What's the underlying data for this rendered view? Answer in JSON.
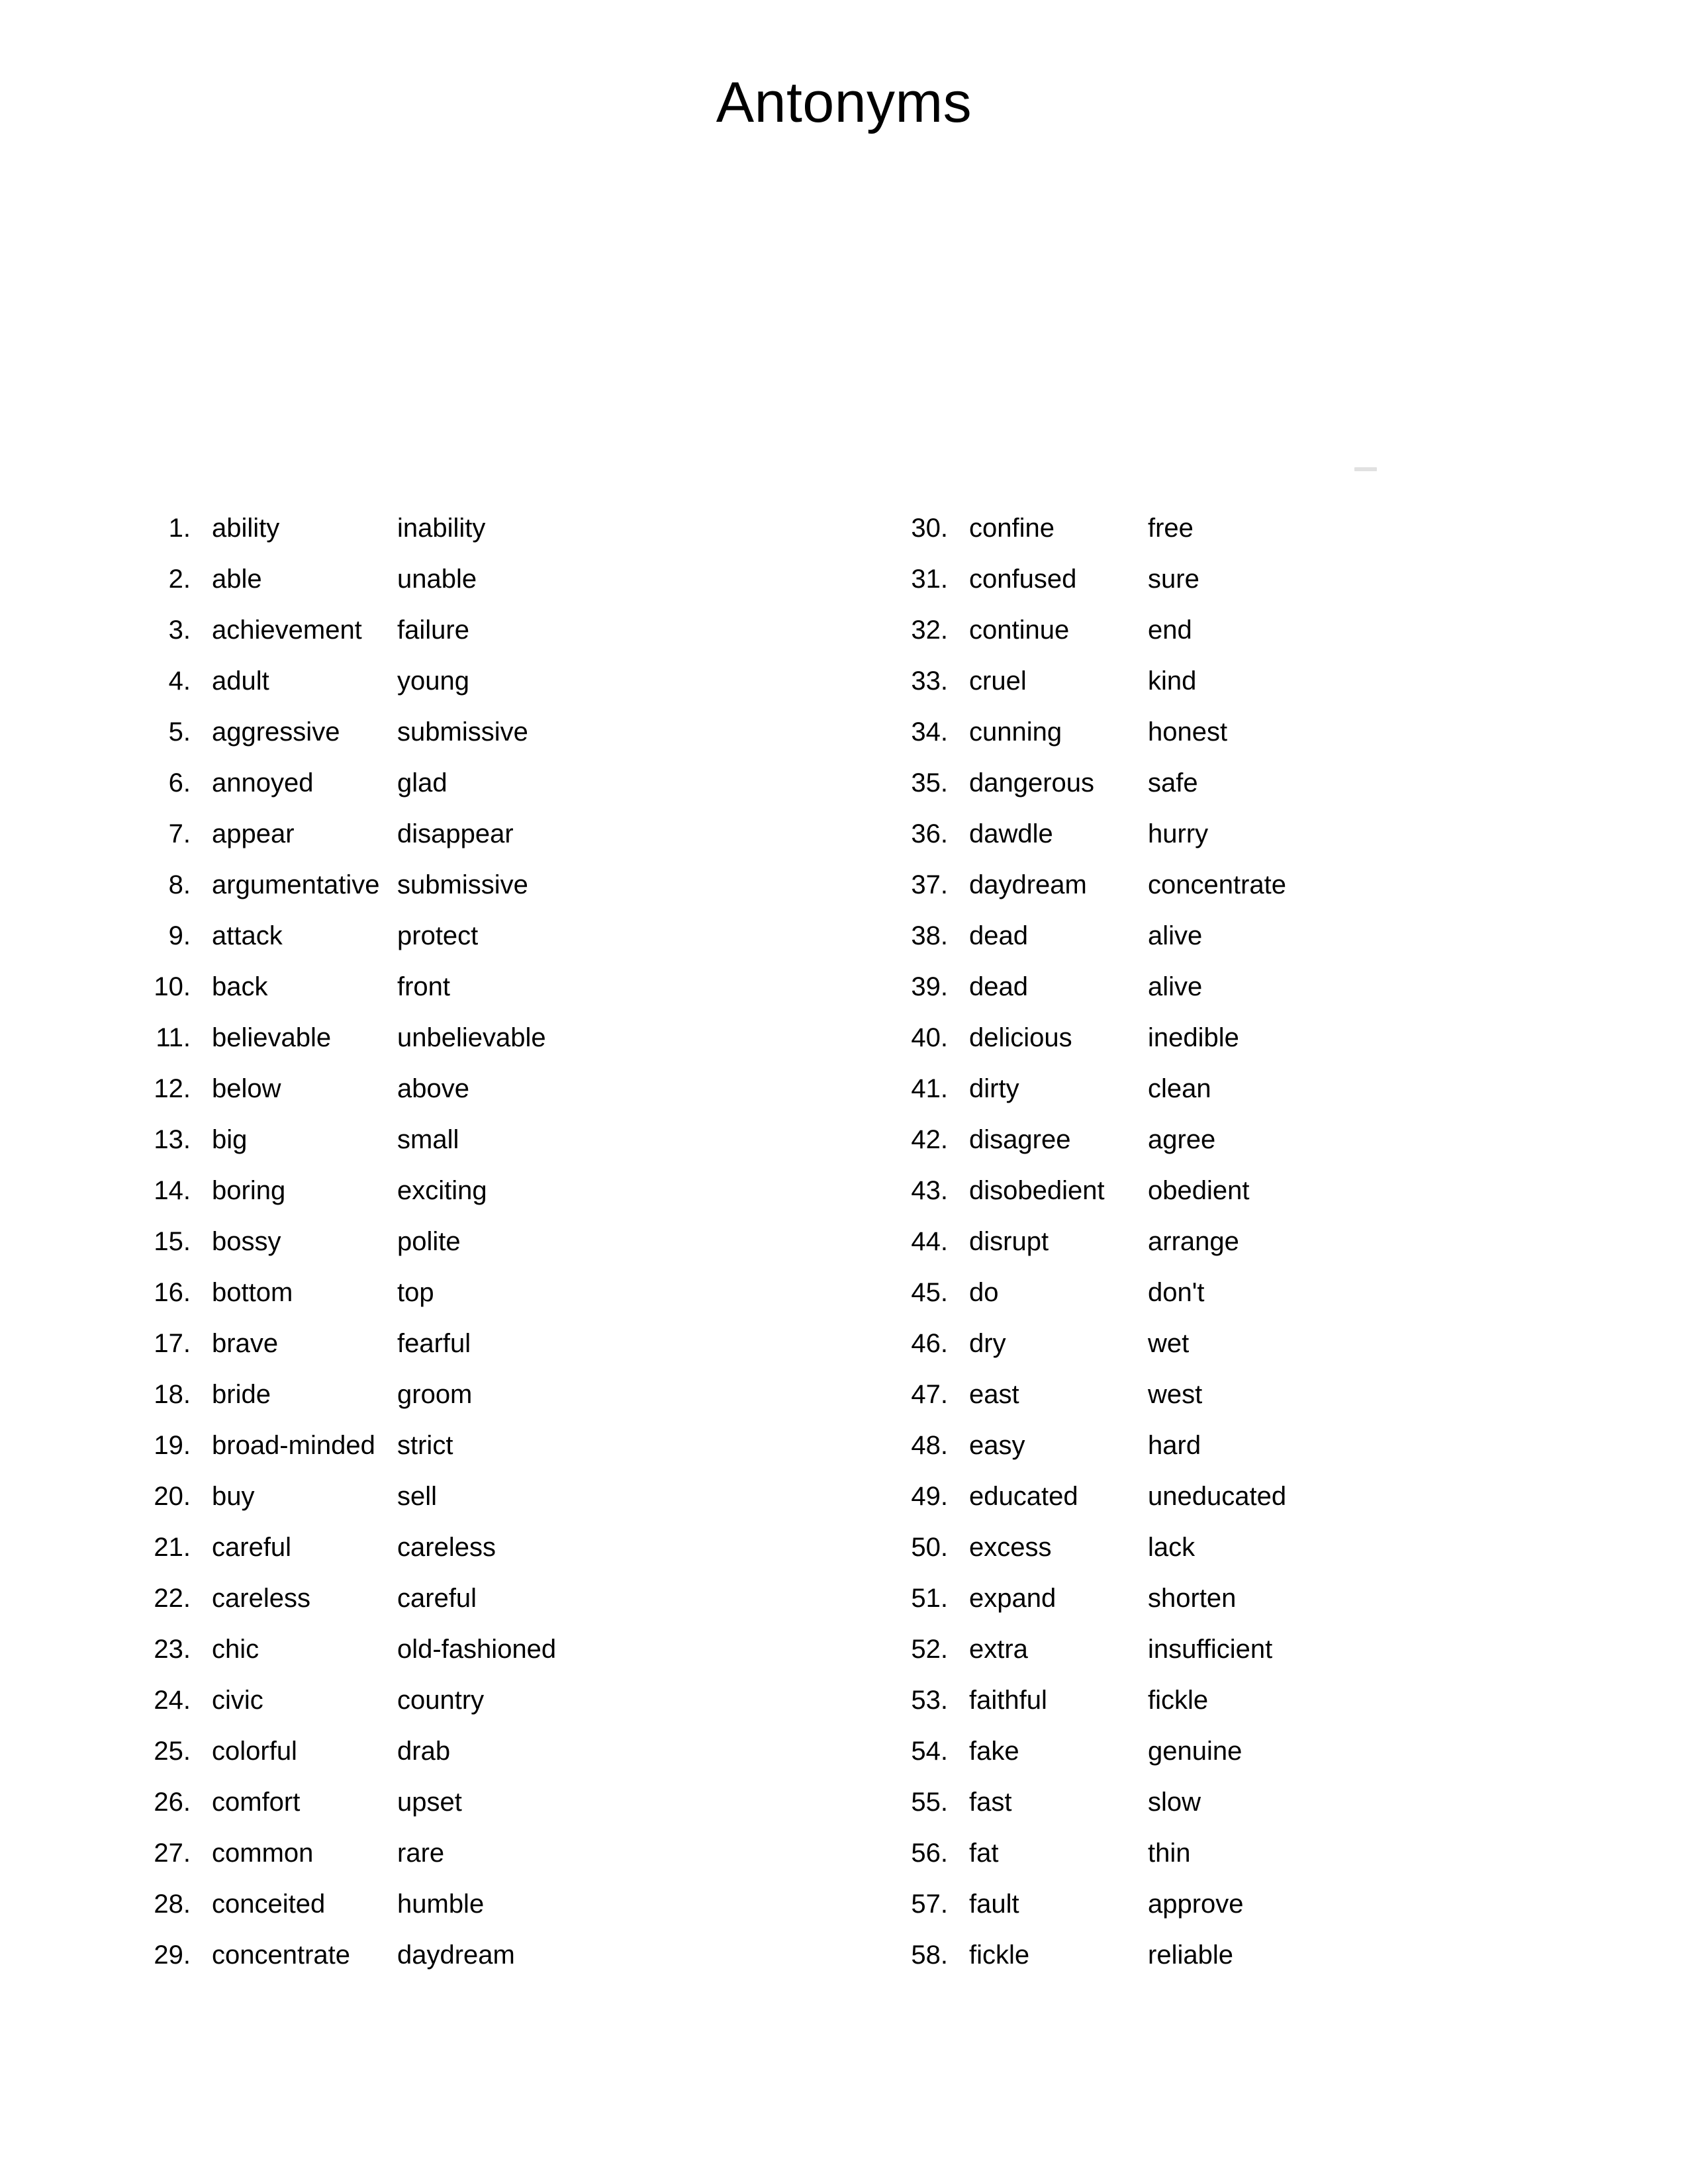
{
  "document": {
    "title": "Antonyms"
  },
  "columns": {
    "left": [
      {
        "num": "1.",
        "word": "ability",
        "antonym": "inability"
      },
      {
        "num": "2.",
        "word": "able",
        "antonym": "unable"
      },
      {
        "num": "3.",
        "word": "achievement",
        "antonym": "failure"
      },
      {
        "num": "4.",
        "word": "adult",
        "antonym": "young"
      },
      {
        "num": "5.",
        "word": "aggressive",
        "antonym": "submissive"
      },
      {
        "num": "6.",
        "word": "annoyed",
        "antonym": "glad"
      },
      {
        "num": "7.",
        "word": "appear",
        "antonym": "disappear"
      },
      {
        "num": "8.",
        "word": "argumentative",
        "antonym": "submissive"
      },
      {
        "num": "9.",
        "word": "attack",
        "antonym": "protect"
      },
      {
        "num": "10.",
        "word": "back",
        "antonym": "front"
      },
      {
        "num": "11.",
        "word": "believable",
        "antonym": "unbelievable"
      },
      {
        "num": "12.",
        "word": "below",
        "antonym": "above"
      },
      {
        "num": "13.",
        "word": "big",
        "antonym": "small"
      },
      {
        "num": "14.",
        "word": "boring",
        "antonym": "exciting"
      },
      {
        "num": "15.",
        "word": "bossy",
        "antonym": "polite"
      },
      {
        "num": "16.",
        "word": "bottom",
        "antonym": "top"
      },
      {
        "num": "17.",
        "word": "brave",
        "antonym": "fearful"
      },
      {
        "num": "18.",
        "word": "bride",
        "antonym": "groom"
      },
      {
        "num": "19.",
        "word": "broad-minded",
        "antonym": "strict"
      },
      {
        "num": "20.",
        "word": "buy",
        "antonym": "sell"
      },
      {
        "num": "21.",
        "word": "careful",
        "antonym": "careless"
      },
      {
        "num": "22.",
        "word": "careless",
        "antonym": "careful"
      },
      {
        "num": "23.",
        "word": "chic",
        "antonym": "old-fashioned"
      },
      {
        "num": "24.",
        "word": "civic",
        "antonym": "country"
      },
      {
        "num": "25.",
        "word": "colorful",
        "antonym": "drab"
      },
      {
        "num": "26.",
        "word": "comfort",
        "antonym": "upset"
      },
      {
        "num": "27.",
        "word": "common",
        "antonym": "rare"
      },
      {
        "num": "28.",
        "word": "conceited",
        "antonym": "humble"
      },
      {
        "num": "29.",
        "word": "concentrate",
        "antonym": "daydream"
      }
    ],
    "right": [
      {
        "num": "30.",
        "word": "confine",
        "antonym": "free"
      },
      {
        "num": "31.",
        "word": "confused",
        "antonym": "sure"
      },
      {
        "num": "32.",
        "word": "continue",
        "antonym": "end"
      },
      {
        "num": "33.",
        "word": "cruel",
        "antonym": "kind"
      },
      {
        "num": "34.",
        "word": "cunning",
        "antonym": "honest"
      },
      {
        "num": "35.",
        "word": "dangerous",
        "antonym": "safe"
      },
      {
        "num": "36.",
        "word": "dawdle",
        "antonym": "hurry"
      },
      {
        "num": "37.",
        "word": "daydream",
        "antonym": "concentrate"
      },
      {
        "num": "38.",
        "word": "dead",
        "antonym": "alive"
      },
      {
        "num": "39.",
        "word": "dead",
        "antonym": "alive"
      },
      {
        "num": "40.",
        "word": "delicious",
        "antonym": "inedible"
      },
      {
        "num": "41.",
        "word": "dirty",
        "antonym": "clean"
      },
      {
        "num": "42.",
        "word": "disagree",
        "antonym": "agree"
      },
      {
        "num": "43.",
        "word": "disobedient",
        "antonym": "obedient"
      },
      {
        "num": "44.",
        "word": "disrupt",
        "antonym": "arrange"
      },
      {
        "num": "45.",
        "word": "do",
        "antonym": "don't"
      },
      {
        "num": "46.",
        "word": "dry",
        "antonym": "wet"
      },
      {
        "num": "47.",
        "word": "east",
        "antonym": "west"
      },
      {
        "num": "48.",
        "word": "easy",
        "antonym": "hard"
      },
      {
        "num": "49.",
        "word": "educated",
        "antonym": "uneducated"
      },
      {
        "num": "50.",
        "word": "excess",
        "antonym": "lack"
      },
      {
        "num": "51.",
        "word": "expand",
        "antonym": "shorten"
      },
      {
        "num": "52.",
        "word": "extra",
        "antonym": "insufficient"
      },
      {
        "num": "53.",
        "word": "faithful",
        "antonym": "fickle"
      },
      {
        "num": "54.",
        "word": "fake",
        "antonym": "genuine"
      },
      {
        "num": "55.",
        "word": "fast",
        "antonym": "slow"
      },
      {
        "num": "56.",
        "word": "fat",
        "antonym": "thin"
      },
      {
        "num": "57.",
        "word": "fault",
        "antonym": "approve"
      },
      {
        "num": "58.",
        "word": "fickle",
        "antonym": "reliable"
      }
    ]
  }
}
